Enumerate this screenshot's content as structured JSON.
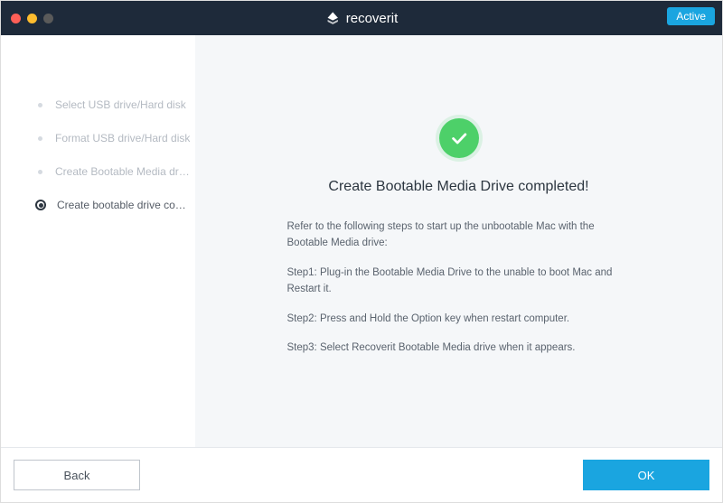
{
  "titlebar": {
    "brand_text": "recoverit",
    "active_badge": "Active"
  },
  "sidebar": {
    "steps": [
      {
        "label": "Select USB drive/Hard disk",
        "active": false
      },
      {
        "label": "Format USB drive/Hard disk",
        "active": false
      },
      {
        "label": "Create Bootable Media drive",
        "active": false
      },
      {
        "label": "Create bootable drive compl...",
        "active": true
      }
    ]
  },
  "main": {
    "heading": "Create Bootable Media Drive completed!",
    "intro": "Refer to the following steps to start up the unbootable Mac with the Bootable Media drive:",
    "step1": "Step1: Plug-in the Bootable Media Drive to the unable to boot Mac and Restart it.",
    "step2": "Step2: Press and Hold the Option key when restart computer.",
    "step3": "Step3: Select Recoverit Bootable Media drive when it appears."
  },
  "footer": {
    "back": "Back",
    "ok": "OK"
  }
}
